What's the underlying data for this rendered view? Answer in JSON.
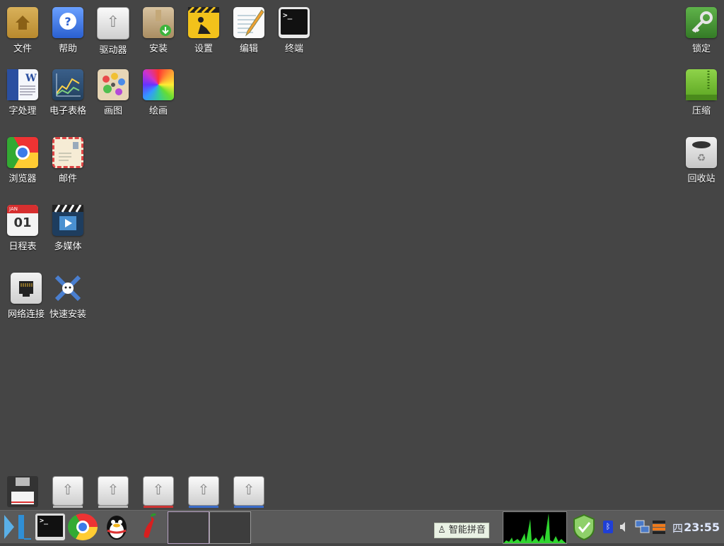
{
  "desktop_icons": {
    "files": "文件",
    "help": "帮助",
    "drive": "驱动器",
    "install": "安装",
    "settings": "设置",
    "editor": "编辑",
    "terminal": "终端",
    "lock": "锁定",
    "word": "字处理",
    "spreadsheet": "电子表格",
    "paint": "画图",
    "draw": "绘画",
    "compress": "压缩",
    "browser": "浏览器",
    "mail": "邮件",
    "trash": "回收站",
    "calendar": "日程表",
    "multimedia": "多媒体",
    "network": "网络连接",
    "quick_install": "快速安装"
  },
  "calendar_glyph": {
    "month": "JAN",
    "day": "01"
  },
  "terminal_glyph": ">_",
  "taskbar": {
    "ime_label": "智能拼音",
    "day_of_week": "四",
    "time": "23:55"
  },
  "colors": {
    "desktop_bg": "#454545",
    "taskbar_bg": "#5a5a5a",
    "accent_green": "#2fd62f"
  }
}
